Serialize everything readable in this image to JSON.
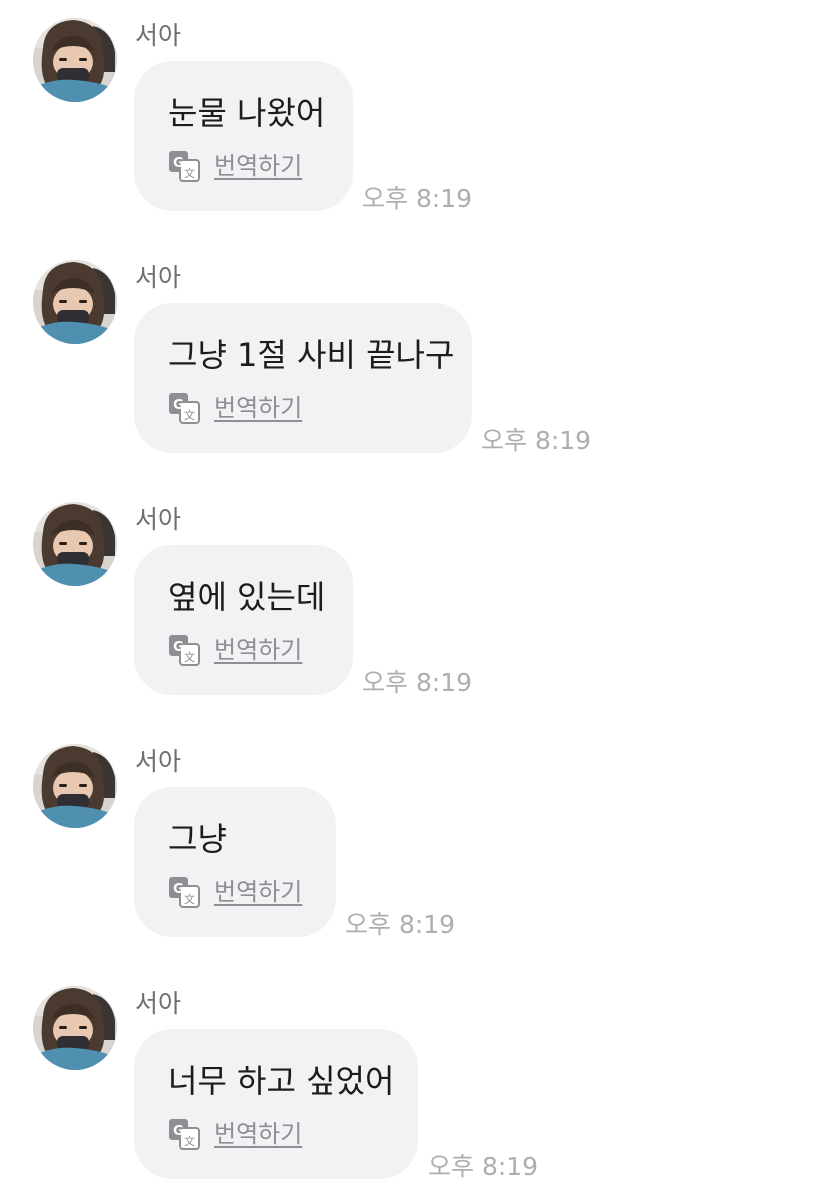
{
  "messages": [
    {
      "sender": "서아",
      "text": "눈물 나왔어",
      "translate_label": "번역하기",
      "time": "오후 8:19"
    },
    {
      "sender": "서아",
      "text": "그냥 1절 사비 끝나구",
      "translate_label": "번역하기",
      "time": "오후 8:19"
    },
    {
      "sender": "서아",
      "text": "옆에 있는데",
      "translate_label": "번역하기",
      "time": "오후 8:19"
    },
    {
      "sender": "서아",
      "text": "그냥",
      "translate_label": "번역하기",
      "time": "오후 8:19"
    },
    {
      "sender": "서아",
      "text": "너무 하고 싶었어",
      "translate_label": "번역하기",
      "time": "오후 8:19"
    }
  ],
  "icons": {
    "avatar": "profile-photo",
    "translate": "translate-icon"
  },
  "colors": {
    "bubble_bg": "#f2f2f5",
    "text": "#1c1c1e",
    "secondary": "#8e8e93",
    "time": "#aeaeb2"
  }
}
